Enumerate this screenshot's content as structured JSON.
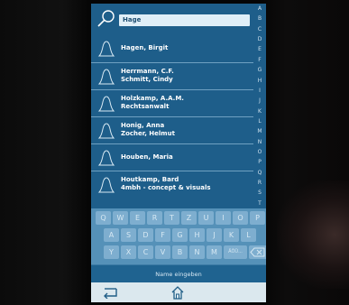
{
  "search": {
    "value": "Hage"
  },
  "contacts": [
    {
      "line1": "Hagen, Birgit",
      "line2": ""
    },
    {
      "line1": "Herrmann, C.F.",
      "line2": "Schmitt, Cindy"
    },
    {
      "line1": "Holzkamp, A.A.M.",
      "line2": "Rechtsanwalt"
    },
    {
      "line1": "Honig, Anna",
      "line2": "Zocher, Helmut"
    },
    {
      "line1": "Houben, Maria",
      "line2": ""
    },
    {
      "line1": "Houtkamp, Bard",
      "line2": "4mbh - concept & visuals"
    }
  ],
  "alphabet": [
    "A",
    "B",
    "C",
    "D",
    "E",
    "F",
    "G",
    "H",
    "I",
    "J",
    "K",
    "L",
    "M",
    "N",
    "O",
    "P",
    "Q",
    "R",
    "S",
    "T"
  ],
  "keyboard": {
    "row1": [
      "Q",
      "W",
      "E",
      "R",
      "T",
      "Z",
      "U",
      "I",
      "O",
      "P"
    ],
    "row2": [
      "A",
      "S",
      "D",
      "F",
      "G",
      "H",
      "J",
      "K",
      "L"
    ],
    "row3": [
      "Y",
      "X",
      "C",
      "V",
      "B",
      "N",
      "M"
    ],
    "special_key": "ÄÖÜ..."
  },
  "prompt": "Name eingeben",
  "icons": {
    "search": "search-icon",
    "bell": "bell-icon",
    "backspace": "backspace-icon",
    "back": "back-arrow-icon",
    "home": "home-icon"
  }
}
